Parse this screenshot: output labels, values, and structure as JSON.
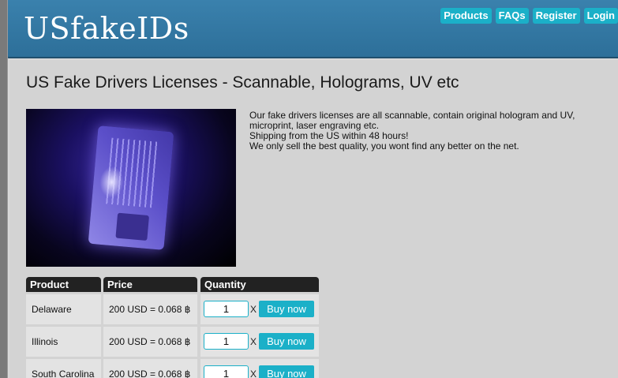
{
  "header": {
    "logo": "USfakeIDs",
    "nav": [
      "Products",
      "FAQs",
      "Register",
      "Login"
    ]
  },
  "page": {
    "title": "US Fake Drivers Licenses - Scannable, Holograms, UV etc",
    "description": [
      "Our fake drivers licenses are all scannable, contain original hologram and UV,",
      "microprint, laser engraving etc.",
      "Shipping from the US within 48 hours!",
      "We only sell the best quality, you wont find any better on the net."
    ]
  },
  "table": {
    "headers": [
      "Product",
      "Price",
      "Quantity"
    ],
    "rows": [
      {
        "product": "Delaware",
        "price": "200 USD = 0.068 ฿",
        "quantity": "1",
        "times": "X",
        "buy": "Buy now"
      },
      {
        "product": "Illinois",
        "price": "200 USD = 0.068 ฿",
        "quantity": "1",
        "times": "X",
        "buy": "Buy now"
      },
      {
        "product": "South Carolina",
        "price": "200 USD = 0.068 ฿",
        "quantity": "1",
        "times": "X",
        "buy": "Buy now"
      }
    ]
  },
  "colors": {
    "header": "#3a81ad",
    "accent": "#1bb0c8",
    "table_header": "#222222",
    "background": "#d3d3d3"
  }
}
